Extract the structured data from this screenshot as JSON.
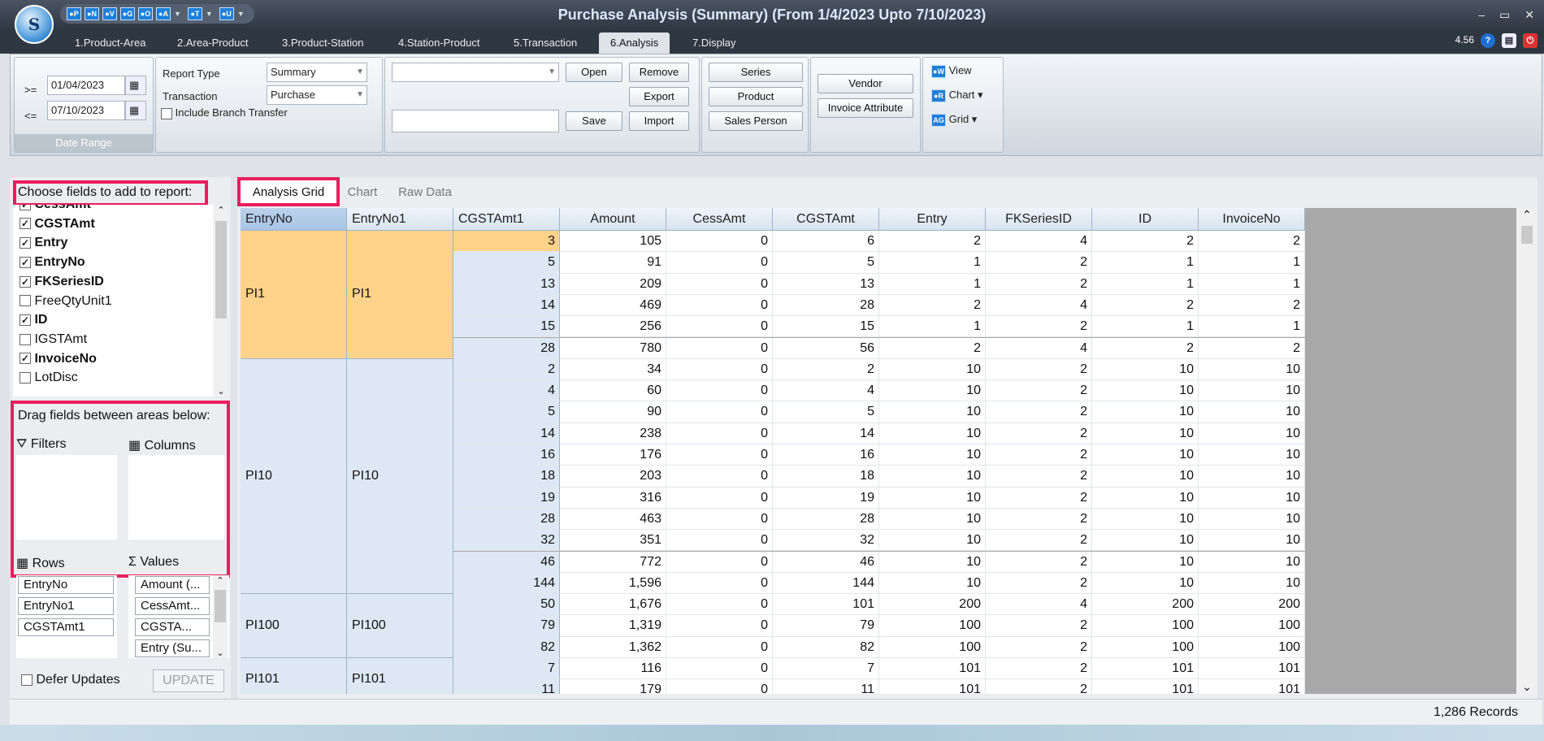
{
  "window": {
    "title": "Purchase Analysis (Summary) (From 1/4/2023 Upto 7/10/2023)",
    "logo_text": "S",
    "minimize": "–",
    "maximize": "▭",
    "close": "✕",
    "version": "4.56"
  },
  "quick_access": [
    {
      "label": "●P"
    },
    {
      "label": "●N"
    },
    {
      "label": "●V"
    },
    {
      "label": "●G"
    },
    {
      "label": "●O"
    },
    {
      "label": "●A"
    },
    {
      "label": "●T"
    },
    {
      "label": "●U"
    }
  ],
  "main_tabs": [
    "1.Product-Area",
    "2.Area-Product",
    "3.Product-Station",
    "4.Station-Product",
    "5.Transaction",
    "6.Analysis",
    "7.Display"
  ],
  "date_range": {
    "from_op": ">=",
    "from": "01/04/2023",
    "to_op": "<=",
    "to": "07/10/2023",
    "caption": "Date Range"
  },
  "report": {
    "type_label": "Report Type",
    "type_value": "Summary",
    "transaction_label": "Transaction",
    "transaction_value": "Purchase",
    "branch_label": "Include Branch Transfer"
  },
  "layout_group": {
    "open": "Open",
    "remove": "Remove",
    "export": "Export",
    "save": "Save",
    "import": "Import"
  },
  "filter_buttons": {
    "series": "Series",
    "product": "Product",
    "sales_person": "Sales Person",
    "vendor": "Vendor",
    "invoice_attribute": "Invoice Attribute"
  },
  "view_group": {
    "view": "View",
    "chart": "Chart",
    "grid": "Grid"
  },
  "field_list": {
    "header": "Choose fields to add to report:",
    "items": [
      {
        "label": "CessAmt",
        "checked": true
      },
      {
        "label": "CGSTAmt",
        "checked": true
      },
      {
        "label": "Entry",
        "checked": true
      },
      {
        "label": "EntryNo",
        "checked": true
      },
      {
        "label": "FKSeriesID",
        "checked": true
      },
      {
        "label": "FreeQtyUnit1",
        "checked": false
      },
      {
        "label": "ID",
        "checked": true
      },
      {
        "label": "IGSTAmt",
        "checked": false
      },
      {
        "label": "InvoiceNo",
        "checked": true
      },
      {
        "label": "LotDisc",
        "checked": false
      }
    ]
  },
  "areas": {
    "header": "Drag fields between areas below:",
    "filters": "Filters",
    "columns": "Columns",
    "rows": "Rows",
    "values": "Values",
    "row_fields": [
      "EntryNo",
      "EntryNo1",
      "CGSTAmt1"
    ],
    "value_fields": [
      "Amount (...",
      "CessAmt...",
      "CGSTA...",
      "Entry (Su..."
    ]
  },
  "defer": {
    "label": "Defer Updates",
    "button": "UPDATE"
  },
  "grid_tabs": [
    "Analysis Grid",
    "Chart",
    "Raw Data"
  ],
  "grid": {
    "columns": [
      "EntryNo",
      "EntryNo1",
      "CGSTAmt1",
      "Amount",
      "CessAmt",
      "CGSTAmt",
      "Entry",
      "FKSeriesID",
      "ID",
      "InvoiceNo"
    ],
    "groups": [
      {
        "entry": "PI1",
        "entry1": "PI1",
        "rows": [
          [
            "3",
            "105",
            "0",
            "6",
            "2",
            "4",
            "2",
            "2"
          ],
          [
            "5",
            "91",
            "0",
            "5",
            "1",
            "2",
            "1",
            "1"
          ],
          [
            "13",
            "209",
            "0",
            "13",
            "1",
            "2",
            "1",
            "1"
          ],
          [
            "14",
            "469",
            "0",
            "28",
            "2",
            "4",
            "2",
            "2"
          ],
          [
            "15",
            "256",
            "0",
            "15",
            "1",
            "2",
            "1",
            "1"
          ],
          [
            "28",
            "780",
            "0",
            "56",
            "2",
            "4",
            "2",
            "2"
          ]
        ]
      },
      {
        "entry": "PI10",
        "entry1": "PI10",
        "rows": [
          [
            "2",
            "34",
            "0",
            "2",
            "10",
            "2",
            "10",
            "10"
          ],
          [
            "4",
            "60",
            "0",
            "4",
            "10",
            "2",
            "10",
            "10"
          ],
          [
            "5",
            "90",
            "0",
            "5",
            "10",
            "2",
            "10",
            "10"
          ],
          [
            "14",
            "238",
            "0",
            "14",
            "10",
            "2",
            "10",
            "10"
          ],
          [
            "16",
            "176",
            "0",
            "16",
            "10",
            "2",
            "10",
            "10"
          ],
          [
            "18",
            "203",
            "0",
            "18",
            "10",
            "2",
            "10",
            "10"
          ],
          [
            "19",
            "316",
            "0",
            "19",
            "10",
            "2",
            "10",
            "10"
          ],
          [
            "28",
            "463",
            "0",
            "28",
            "10",
            "2",
            "10",
            "10"
          ],
          [
            "32",
            "351",
            "0",
            "32",
            "10",
            "2",
            "10",
            "10"
          ],
          [
            "46",
            "772",
            "0",
            "46",
            "10",
            "2",
            "10",
            "10"
          ],
          [
            "144",
            "1,596",
            "0",
            "144",
            "10",
            "2",
            "10",
            "10"
          ]
        ]
      },
      {
        "entry": "PI100",
        "entry1": "PI100",
        "rows": [
          [
            "50",
            "1,676",
            "0",
            "101",
            "200",
            "4",
            "200",
            "200"
          ],
          [
            "79",
            "1,319",
            "0",
            "79",
            "100",
            "2",
            "100",
            "100"
          ],
          [
            "82",
            "1,362",
            "0",
            "82",
            "100",
            "2",
            "100",
            "100"
          ]
        ]
      },
      {
        "entry": "PI101",
        "entry1": "PI101",
        "rows": [
          [
            "7",
            "116",
            "0",
            "7",
            "101",
            "2",
            "101",
            "101"
          ],
          [
            "11",
            "179",
            "0",
            "11",
            "101",
            "2",
            "101",
            "101"
          ]
        ]
      }
    ]
  },
  "status": {
    "records": "1,286 Records"
  },
  "colors": {
    "highlight": "#e91e5e",
    "selected": "#ffd28a",
    "rowheader": "#dde8f4"
  }
}
